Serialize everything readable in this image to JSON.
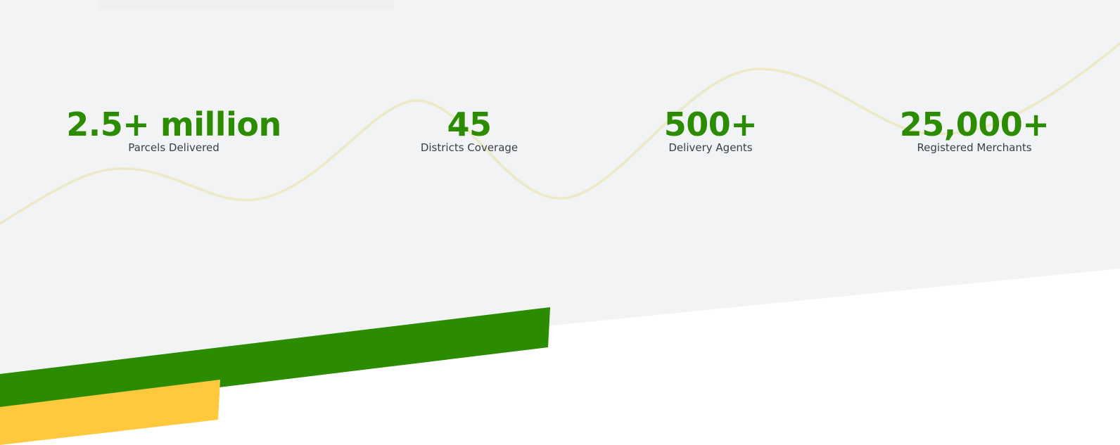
{
  "colors": {
    "section_bg": "#f1f3f5",
    "white": "#ffffff",
    "accent_green": "#2b8c00",
    "accent_yellow": "#ffc83d",
    "wave": "#ece9c4",
    "wave_faint": "#edeee6",
    "label_text": "#3b3e44"
  },
  "stats": [
    {
      "value": "2.5+ million",
      "label": "Parcels Delivered"
    },
    {
      "value": "45",
      "label": "Districts Coverage"
    },
    {
      "value": "500+",
      "label": "Delivery Agents"
    },
    {
      "value": "25,000+",
      "label": "Registered Merchants"
    }
  ]
}
